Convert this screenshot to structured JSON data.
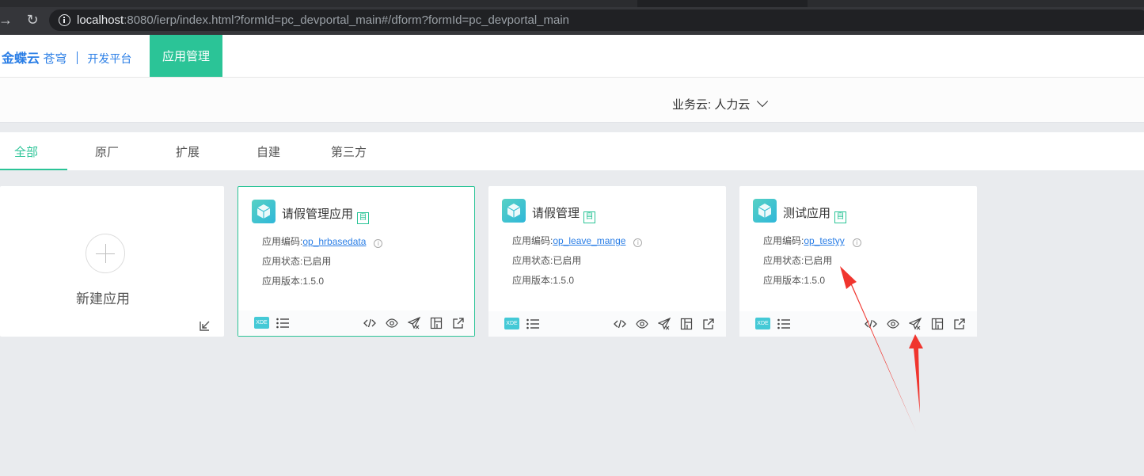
{
  "browser": {
    "url_host": "localhost",
    "url_rest": ":8080/ierp/index.html?formId=pc_devportal_main#/dform?formId=pc_devportal_main"
  },
  "header": {
    "logo_main": "金蝶云",
    "logo_sub": "苍穹",
    "logo_platform": "开发平台",
    "active_nav": "应用管理"
  },
  "cloud": {
    "label": "业务云:",
    "value": "人力云"
  },
  "tabs": [
    {
      "label": "全部",
      "active": true
    },
    {
      "label": "原厂"
    },
    {
      "label": "扩展"
    },
    {
      "label": "自建"
    },
    {
      "label": "第三方"
    }
  ],
  "new_app": {
    "label": "新建应用"
  },
  "cards": [
    {
      "title": "请假管理应用",
      "badge": "自",
      "code_label": "应用编码:",
      "code": "op_hrbasedata",
      "status_label": "应用状态:",
      "status": "已启用",
      "version_label": "应用版本:",
      "version": "1.5.0",
      "footer_badge": "XDE"
    },
    {
      "title": "请假管理",
      "badge": "自",
      "code_label": "应用编码:",
      "code": "op_leave_mange",
      "status_label": "应用状态:",
      "status": "已启用",
      "version_label": "应用版本:",
      "version": "1.5.0",
      "footer_badge": "XDE"
    },
    {
      "title": "测试应用",
      "badge": "自",
      "code_label": "应用编码:",
      "code": "op_testyy",
      "status_label": "应用状态:",
      "status": "已启用",
      "version_label": "应用版本:",
      "version": "1.5.0",
      "footer_badge": "XDE"
    }
  ],
  "colors": {
    "accent": "#2bc497",
    "link": "#2a7ee6",
    "annotation": "#f0352e"
  }
}
